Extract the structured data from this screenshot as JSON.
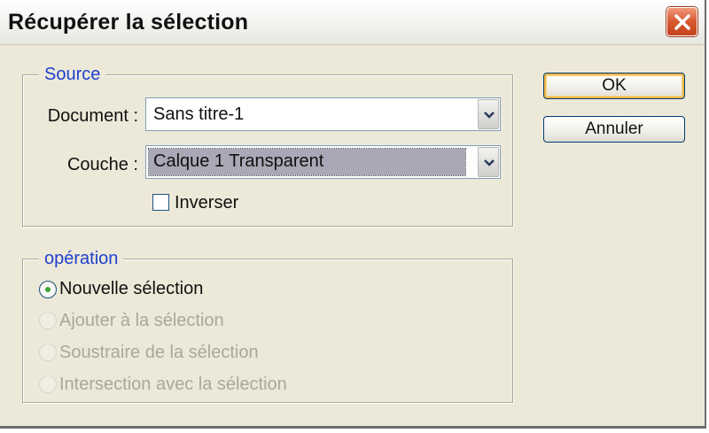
{
  "window": {
    "title": "Récupérer la sélection"
  },
  "source": {
    "legend": "Source",
    "document_label": "Document :",
    "document_value": "Sans titre-1",
    "layer_label": "Couche :",
    "layer_value": "Calque 1 Transparent",
    "invert_label": "Inverser",
    "invert_checked": false
  },
  "operation": {
    "legend": "opération",
    "options": [
      {
        "label": "Nouvelle sélection",
        "checked": true,
        "enabled": true
      },
      {
        "label": "Ajouter à la sélection",
        "checked": false,
        "enabled": false
      },
      {
        "label": "Soustraire de la sélection",
        "checked": false,
        "enabled": false
      },
      {
        "label": "Intersection avec la sélection",
        "checked": false,
        "enabled": false
      }
    ]
  },
  "buttons": {
    "ok": "OK",
    "cancel": "Annuler"
  },
  "icons": {
    "close": "close-icon",
    "dropdown": "chevron-down-icon"
  },
  "colors": {
    "legend_text": "#1f3fd0",
    "close_button": "#d8582f",
    "dialog_bg": "#ece9d8",
    "disabled_text": "#aca899"
  }
}
